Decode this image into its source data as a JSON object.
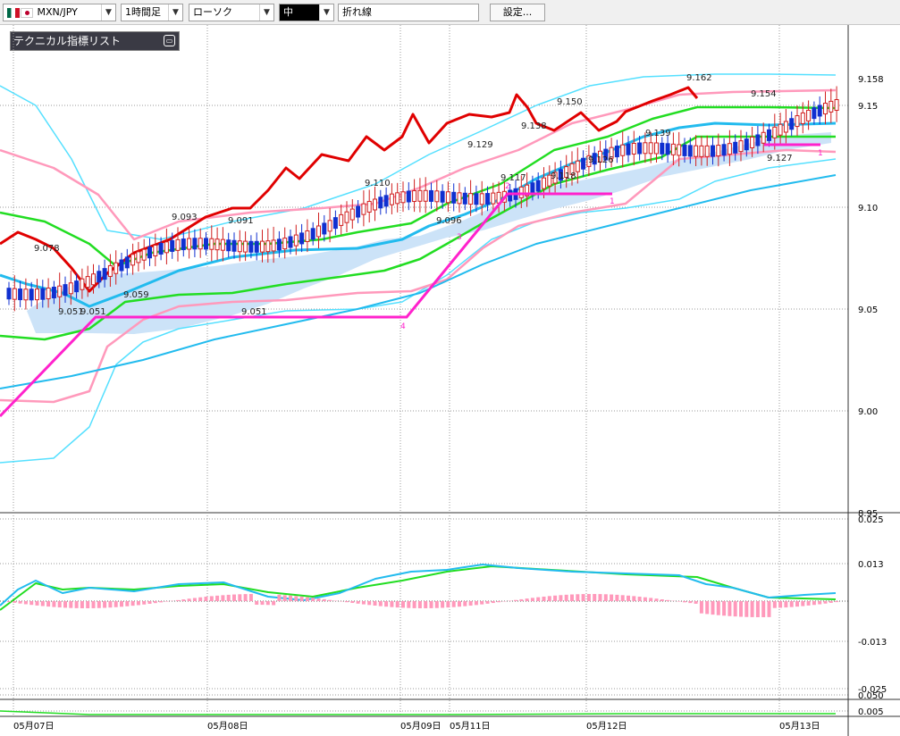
{
  "toolbar": {
    "symbol": "MXN/JPY",
    "timeframe": "1時間足",
    "chart_type": "ローソク",
    "color_mode": "中",
    "overlay": "折れ線",
    "settings": "設定..."
  },
  "indicator_panel": {
    "label": "テクニカル指標リスト"
  },
  "colors": {
    "candle_up": "#d02020",
    "candle_down": "#1030d0",
    "zigzag": "#ff22cc",
    "line_red": "#e00000",
    "bb_outer": "#55e0ff",
    "bb_pink": "#ff99bb",
    "ichimoku_green": "#22dd22",
    "ichimoku_blue": "#22bbee",
    "cloud": "#cce3f8"
  },
  "chart_data": {
    "type": "candlestick",
    "price_axis": [
      "9.158",
      "9.15",
      "9.10",
      "9.05",
      "9.00",
      "8.95"
    ],
    "osc_axis": [
      "0.025",
      "0.013",
      "-0.013",
      "-0.025"
    ],
    "lower_axis": [
      "0.050",
      "0.005"
    ],
    "x_axis": [
      "05月07日",
      "05月08日",
      "05月09日",
      "05月11日",
      "05月12日",
      "05月13日"
    ],
    "annotations": [
      "9.078",
      "9.093",
      "9.091",
      "9.110",
      "9.129",
      "9.138",
      "9.150",
      "9.162",
      "9.154",
      "9.059",
      "9.051",
      "9.051",
      "9.051",
      "9.096",
      "9.117",
      "9.118",
      "9.126",
      "9.139",
      "9.127"
    ],
    "wave_labels": [
      "1",
      "2",
      "3",
      "4",
      "1"
    ],
    "ylim": [
      8.95,
      9.17
    ]
  }
}
